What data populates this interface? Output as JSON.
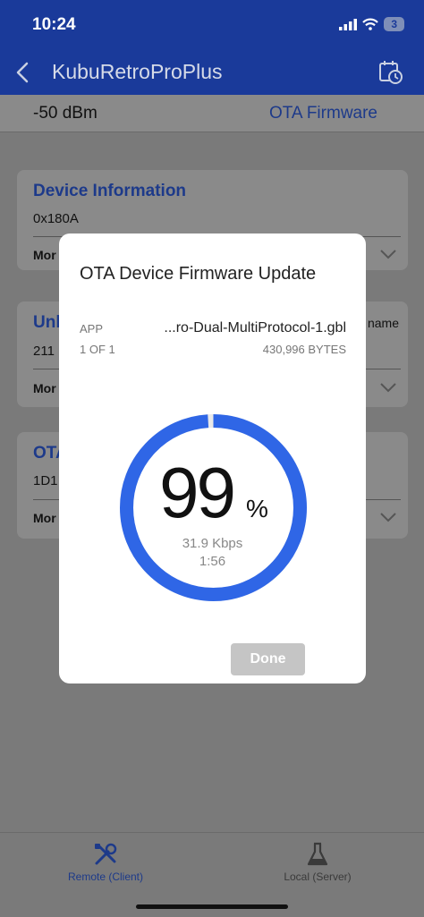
{
  "status_bar": {
    "time": "10:24",
    "battery": "3",
    "icons": [
      "signal-icon",
      "wifi-icon",
      "battery-icon"
    ]
  },
  "nav": {
    "title": "KubuRetroProPlus",
    "back_icon": "chevron-left-icon",
    "history_icon": "calendar-clock-icon"
  },
  "info_bar": {
    "rssi": "-50 dBm",
    "ota_link": "OTA Firmware"
  },
  "cards": [
    {
      "title": "Device Information",
      "subtitle": "0x180A",
      "more": "Mor"
    },
    {
      "title": "Unk",
      "subtitle": "211",
      "more": "Mor",
      "extra": "name"
    },
    {
      "title": "OTA",
      "subtitle": "1D1",
      "more": "Mor"
    }
  ],
  "dialog": {
    "title": "OTA Device Firmware Update",
    "app_label": "APP",
    "file_name": "...ro-Dual-MultiProtocol-1.gbl",
    "count": "1 OF 1",
    "bytes": "430,996  BYTES",
    "progress": 0.99,
    "percent": "99",
    "percent_sign": "%",
    "speed": "31.9  Kbps",
    "elapsed": "1:56",
    "done_label": "Done"
  },
  "tabs": [
    {
      "label": "Remote (Client)",
      "icon": "tools-icon",
      "active": true
    },
    {
      "label": "Local (Server)",
      "icon": "flask-icon",
      "active": false
    }
  ],
  "colors": {
    "brand_blue": "#1a3a9a",
    "ring_blue": "#2f66e6",
    "dim_overlay": "#7a7a7a"
  }
}
